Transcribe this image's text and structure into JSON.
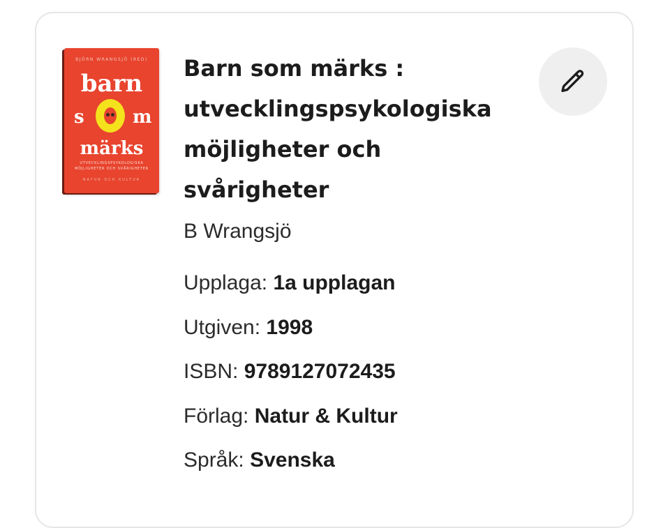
{
  "book": {
    "title": "Barn som märks : utvecklingspsykologiska möjligheter och svårigheter",
    "author": "B Wrangsjö",
    "cover": {
      "author_line": "BJÖRN WRANGSJÖ (RED)",
      "word1": "barn",
      "word2_left": "s",
      "word2_right": "m",
      "word3": "märks",
      "subtitle_line1": "UTVECKLINGSPSYKOLOGISKA",
      "subtitle_line2": "MÖJLIGHETER OCH SVÅRIGHETER",
      "publisher_line": "NATUR OCH KULTUR",
      "background_color": "#e8442e",
      "accent_color": "#f4e21d"
    }
  },
  "details": [
    {
      "label": "Upplaga:",
      "value": "1a upplagan"
    },
    {
      "label": "Utgiven:",
      "value": "1998"
    },
    {
      "label": "ISBN:",
      "value": "9789127072435"
    },
    {
      "label": "Förlag:",
      "value": "Natur & Kultur"
    },
    {
      "label": "Språk:",
      "value": "Svenska"
    }
  ],
  "edit": {
    "icon": "pencil-icon"
  }
}
